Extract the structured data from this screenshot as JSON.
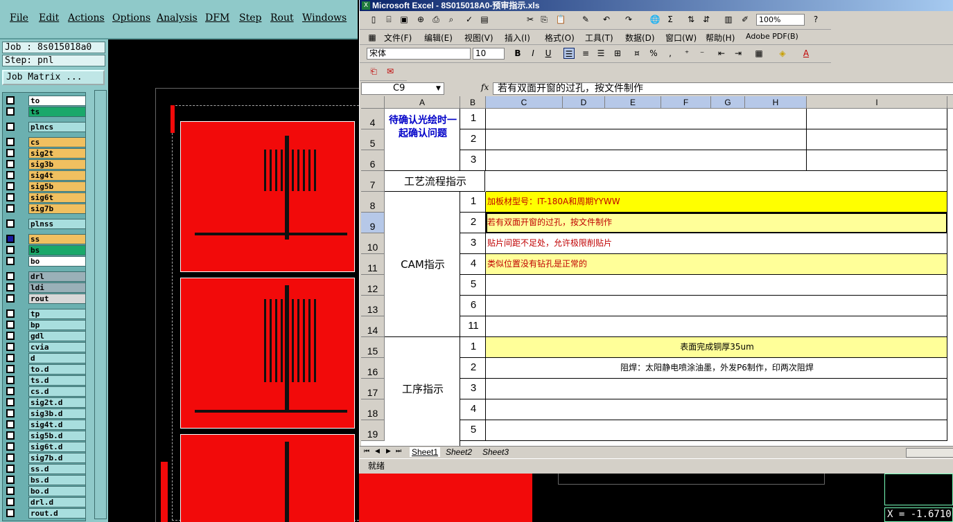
{
  "cam": {
    "menu": [
      "File",
      "Edit",
      "Actions",
      "Options",
      "Analysis",
      "DFM",
      "Step",
      "Rout",
      "Windows"
    ],
    "job_label": "Job : 8s015018a0",
    "step_label": "Step: pnl",
    "job_matrix": "Job Matrix ...",
    "layers": [
      {
        "name": "to",
        "color": "#ffffff"
      },
      {
        "name": "ts",
        "color": "#1aa86a"
      },
      {
        "name": "plncs",
        "color": "#a8dede"
      },
      {
        "name": "cs",
        "color": "#f0c060"
      },
      {
        "name": "sig2t",
        "color": "#f0c060"
      },
      {
        "name": "sig3b",
        "color": "#f0c060"
      },
      {
        "name": "sig4t",
        "color": "#f0c060"
      },
      {
        "name": "sig5b",
        "color": "#f0c060"
      },
      {
        "name": "sig6t",
        "color": "#f0c060"
      },
      {
        "name": "sig7b",
        "color": "#f0c060"
      },
      {
        "name": "plnss",
        "color": "#a8dede"
      },
      {
        "name": "ss",
        "color": "#f0c060"
      },
      {
        "name": "bs",
        "color": "#1aa86a"
      },
      {
        "name": "bo",
        "color": "#ffffff"
      },
      {
        "name": "drl",
        "color": "#9ab0b8"
      },
      {
        "name": "ldi",
        "color": "#9ab0b8"
      },
      {
        "name": "rout",
        "color": "#d8d8d8"
      },
      {
        "name": "tp",
        "color": "#a8dede"
      },
      {
        "name": "bp",
        "color": "#a8dede"
      },
      {
        "name": "gdl",
        "color": "#a8dede"
      },
      {
        "name": "cvia",
        "color": "#a8dede"
      },
      {
        "name": "d",
        "color": "#a8dede"
      },
      {
        "name": "to.d",
        "color": "#a8dede"
      },
      {
        "name": "ts.d",
        "color": "#a8dede"
      },
      {
        "name": "cs.d",
        "color": "#a8dede"
      },
      {
        "name": "sig2t.d",
        "color": "#a8dede"
      },
      {
        "name": "sig3b.d",
        "color": "#a8dede"
      },
      {
        "name": "sig4t.d",
        "color": "#a8dede"
      },
      {
        "name": "sig5b.d",
        "color": "#a8dede"
      },
      {
        "name": "sig6t.d",
        "color": "#a8dede"
      },
      {
        "name": "sig7b.d",
        "color": "#a8dede"
      },
      {
        "name": "ss.d",
        "color": "#a8dede"
      },
      {
        "name": "bs.d",
        "color": "#a8dede"
      },
      {
        "name": "bo.d",
        "color": "#a8dede"
      },
      {
        "name": "drl.d",
        "color": "#a8dede"
      },
      {
        "name": "rout.d",
        "color": "#a8dede"
      }
    ],
    "coord_readout": "X = -1.6710"
  },
  "excel": {
    "title": "Microsoft Excel - 8S015018A0-预审指示.xls",
    "menu": [
      "文件(F)",
      "编辑(E)",
      "视图(V)",
      "插入(I)",
      "格式(O)",
      "工具(T)",
      "数据(D)",
      "窗口(W)",
      "帮助(H)",
      "Adobe PDF(B)"
    ],
    "zoom": "100%",
    "font_name": "宋体",
    "font_size": "10",
    "name_box": "C9",
    "fx": "fx",
    "formula": "若有双面开窗的过孔，按文件制作",
    "columns": [
      "A",
      "B",
      "C",
      "D",
      "E",
      "F",
      "G",
      "H",
      "I"
    ],
    "rows": [
      "4",
      "5",
      "6",
      "7",
      "8",
      "9",
      "10",
      "11",
      "12",
      "13",
      "14",
      "15",
      "16",
      "17",
      "18",
      "19"
    ],
    "a_confirm": "待确认光绘时一起确认问题",
    "a_process": "工艺流程指示",
    "a_cam": "CAM指示",
    "a_step": "工序指示",
    "b_values": [
      "1",
      "2",
      "3",
      "",
      "1",
      "2",
      "3",
      "4",
      "5",
      "6",
      "11",
      "1",
      "2",
      "3",
      "4",
      "5"
    ],
    "c_values": [
      "",
      "",
      "",
      "",
      "加板材型号：IT-180A和周期YYWW",
      "若有双面开窗的过孔，按文件制作",
      "贴片间距不足处，允许极限削贴片",
      "类似位置没有钻孔是正常的",
      "",
      "",
      "",
      "表面完成铜厚35um",
      "阻焊：太阳静电喷涂油墨，外发P6制作，印两次阻焊",
      "",
      "",
      ""
    ],
    "sheets": [
      "Sheet1",
      "Sheet2",
      "Sheet3"
    ],
    "status": "就绪"
  }
}
